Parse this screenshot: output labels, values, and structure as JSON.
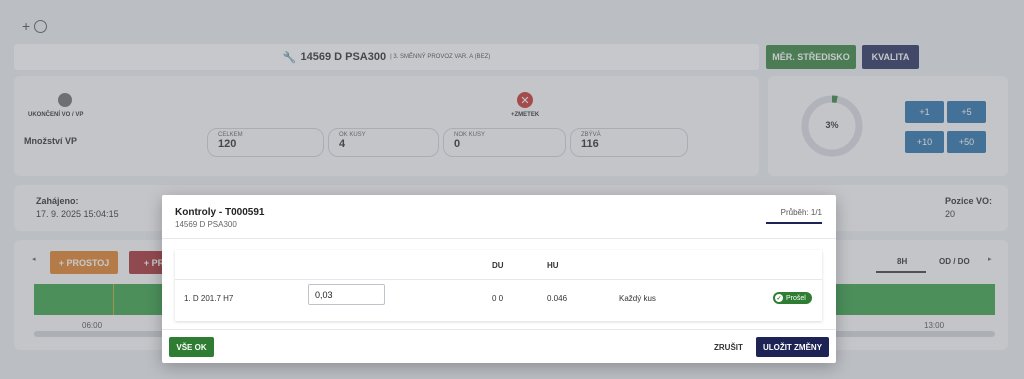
{
  "header": {
    "code": "14569 D PSA300",
    "sub": "| 3. SMĚNNÝ PROVOZ VAR. A (BEZ)"
  },
  "top_buttons": {
    "strediska": "MĚR. STŘEDISKO",
    "kvalita": "KVALITA"
  },
  "actions": {
    "ukonceni": "UKONČENÍ VO / VP",
    "zmetek": "+ZMETEK"
  },
  "quantity": {
    "label": "Množství VP",
    "fields": [
      {
        "label": "CELKEM",
        "value": "120"
      },
      {
        "label": "OK KUSY",
        "value": "4"
      },
      {
        "label": "NOK KUSY",
        "value": "0"
      },
      {
        "label": "ZBÝVÁ",
        "value": "116"
      }
    ]
  },
  "progress": {
    "percent_label": "3%",
    "fraction": 0.03
  },
  "increments": [
    "+1",
    "+5",
    "+10",
    "+50"
  ],
  "info": {
    "started_label": "Zahájeno:",
    "started_value": "17. 9. 2025 15:04:15",
    "position_label": "Pozice VO:",
    "position_value": "20"
  },
  "timeline": {
    "prostoj": "+ PROSTOJ",
    "pro_partial": "+ PR",
    "tab_8h": "8H",
    "tab_odo": "OD / DO",
    "t1": "06:00",
    "t2": "13:00"
  },
  "modal": {
    "title": "Kontroly - T000591",
    "subtitle": "14569 D PSA300",
    "tab": "Průběh: 1/1",
    "headers": {
      "du": "DU",
      "hu": "HU"
    },
    "row": {
      "name": "1. D 201.7 H7",
      "value": "0,03",
      "du": "0 0",
      "hu": "0.046",
      "frequency": "Každý kus",
      "status": "Prošel"
    },
    "buttons": {
      "all_ok": "VŠE OK",
      "cancel": "ZRUŠIT",
      "save": "ULOŽIT ZMĚNY"
    }
  },
  "colors": {
    "green": "#2e7d32",
    "navy": "#1d2355",
    "blue": "#1f6aa5",
    "orange": "#e07a1f",
    "red": "#a3262a"
  }
}
